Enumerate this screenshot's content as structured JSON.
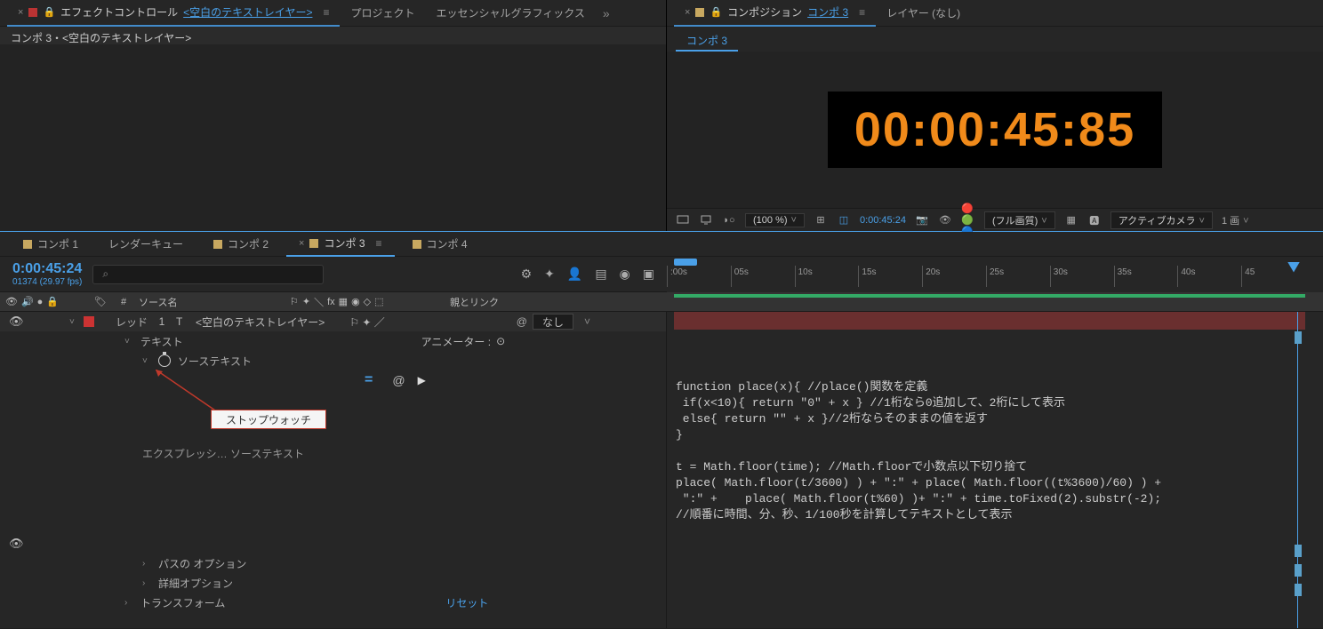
{
  "topLeft": {
    "tab1_prefix": "エフェクトコントロール",
    "tab1_link": "<空白のテキストレイヤー>",
    "tab2": "プロジェクト",
    "tab3": "エッセンシャルグラフィックス",
    "breadcrumb": "コンポ 3・<空白のテキストレイヤー>"
  },
  "topRight": {
    "tab1_prefix": "コンポジション",
    "tab1_link": "コンポ 3",
    "tab2": "レイヤー (なし)",
    "subtab": "コンポ 3",
    "timecode": "00:00:45:85",
    "toolbar": {
      "zoom": "(100 %)",
      "time": "0:00:45:24",
      "quality": "(フル画質)",
      "camera": "アクティブカメラ",
      "views": "1 画"
    }
  },
  "timeline": {
    "tabs": [
      "コンポ 1",
      "レンダーキュー",
      "コンポ 2",
      "コンポ 3",
      "コンポ 4"
    ],
    "activeIdx": 3,
    "time": "0:00:45:24",
    "fps": "01374 (29.97 fps)",
    "searchPlaceholder": "",
    "ticks": [
      ":00s",
      "05s",
      "10s",
      "15s",
      "20s",
      "25s",
      "30s",
      "35s",
      "40s",
      "45"
    ],
    "cols": {
      "num": "#",
      "source": "ソース名",
      "parent": "親とリンク",
      "none": "なし"
    },
    "layer": {
      "tag": "レッド",
      "num": "1",
      "name": "<空白のテキストレイヤー>"
    },
    "rows": {
      "text": "テキスト",
      "animator": "アニメーター :",
      "sourceText": "ソーステキスト",
      "exprLabel": "エクスプレッシ… ソーステキスト",
      "pathOpt": "パスの オプション",
      "advOpt": "詳細オプション",
      "transform": "トランスフォーム",
      "reset": "リセット"
    },
    "callout": "ストップウォッチ",
    "expression": "function place(x){ //place()関数を定義\n if(x<10){ return \"0\" + x } //1桁なら0追加して、2桁にして表示\n else{ return \"\" + x }//2桁ならそのままの値を返す\n}\n\nt = Math.floor(time); //Math.floorで小数点以下切り捨て\nplace( Math.floor(t/3600) ) + \":\" + place( Math.floor((t%3600)/60) ) +\n \":\" +    place( Math.floor(t%60) )+ \":\" + time.toFixed(2).substr(-2);\n//順番に時間、分、秒、1/100秒を計算してテキストとして表示"
  }
}
